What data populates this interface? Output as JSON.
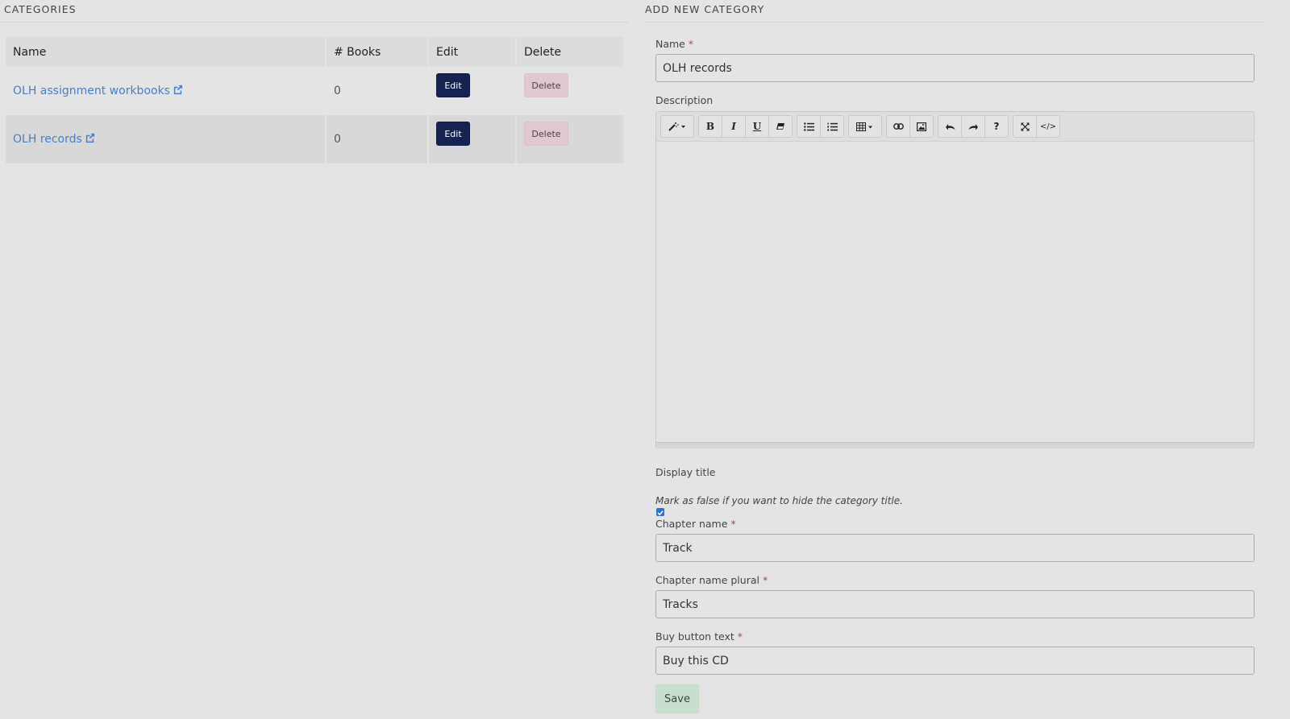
{
  "categories_panel": {
    "title": "CATEGORIES",
    "columns": [
      "Name",
      "# Books",
      "Edit",
      "Delete"
    ],
    "rows": [
      {
        "name": "OLH assignment workbooks",
        "books": "0",
        "edit_label": "Edit",
        "delete_label": "Delete"
      },
      {
        "name": "OLH records",
        "books": "0",
        "edit_label": "Edit",
        "delete_label": "Delete"
      }
    ]
  },
  "form": {
    "title": "ADD NEW CATEGORY",
    "required_marker": "*",
    "name": {
      "label": "Name",
      "value": "OLH records"
    },
    "description": {
      "label": "Description",
      "toolbar": [
        {
          "icon": "magic-wand-dropdown-icon",
          "glyph": "✎▾"
        },
        {
          "icon": "bold-icon",
          "glyph": "B"
        },
        {
          "icon": "italic-icon",
          "glyph": "I"
        },
        {
          "icon": "underline-icon",
          "glyph": "U"
        },
        {
          "icon": "eraser-icon",
          "glyph": "⌫"
        },
        {
          "icon": "unordered-list-icon",
          "glyph": "☰"
        },
        {
          "icon": "ordered-list-icon",
          "glyph": "☷"
        },
        {
          "icon": "table-dropdown-icon",
          "glyph": "▦▾"
        },
        {
          "icon": "link-icon",
          "glyph": "⛓"
        },
        {
          "icon": "image-icon",
          "glyph": "▣"
        },
        {
          "icon": "undo-icon",
          "glyph": "↶"
        },
        {
          "icon": "redo-icon",
          "glyph": "↷"
        },
        {
          "icon": "help-icon",
          "glyph": "?"
        },
        {
          "icon": "fullscreen-icon",
          "glyph": "⤡"
        },
        {
          "icon": "code-view-icon",
          "glyph": "</>"
        }
      ],
      "value": ""
    },
    "display_title": {
      "label": "Display title",
      "checked": true,
      "hint": "Mark as false if you want to hide the category title."
    },
    "chapter_name": {
      "label": "Chapter name",
      "value": "Track"
    },
    "chapter_name_plural": {
      "label": "Chapter name plural",
      "value": "Tracks"
    },
    "buy_button_text": {
      "label": "Buy button text",
      "value": "Buy this CD"
    },
    "save_label": "Save"
  }
}
